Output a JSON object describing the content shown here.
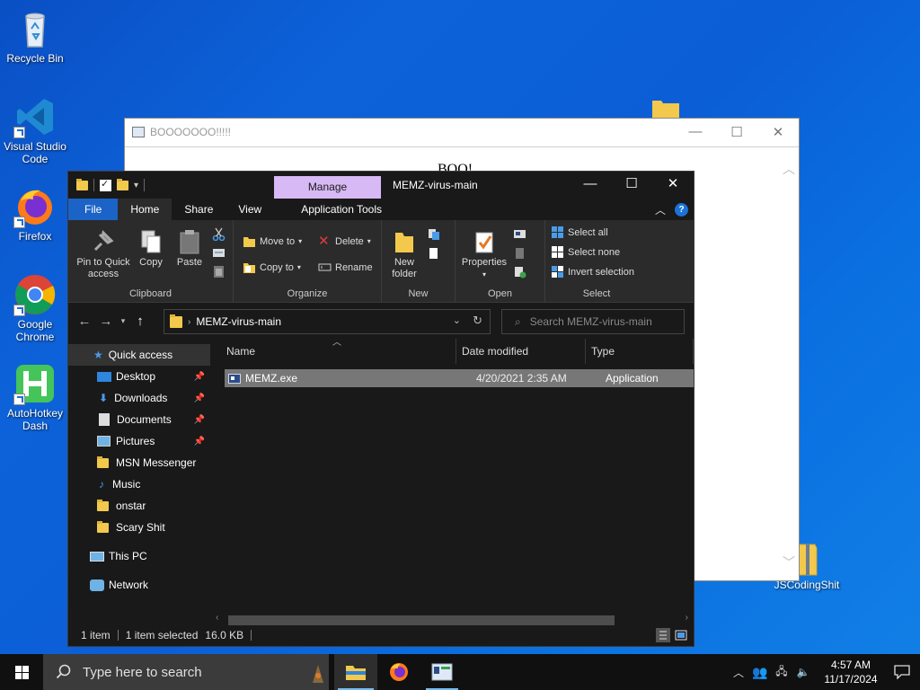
{
  "desktop": {
    "icons": [
      {
        "label": "Recycle Bin"
      },
      {
        "label": "Visual Studio Code"
      },
      {
        "label": "Firefox"
      },
      {
        "label": "Google Chrome"
      },
      {
        "label": "AutoHotkey Dash"
      },
      {
        "label": "JSCodingShit"
      }
    ]
  },
  "boo_window": {
    "title": "BOOOOOOO!!!!!",
    "body_text": "BOO!"
  },
  "explorer": {
    "title": "MEMZ-virus-main",
    "context_tab": "Manage",
    "ribbon_tabs": {
      "file": "File",
      "home": "Home",
      "share": "Share",
      "view": "View",
      "app_tools": "Application Tools"
    },
    "clipboard": {
      "pin": "Pin to Quick access",
      "copy": "Copy",
      "paste": "Paste",
      "label": "Clipboard"
    },
    "organize": {
      "move_to": "Move to",
      "copy_to": "Copy to",
      "delete": "Delete",
      "rename": "Rename",
      "label": "Organize"
    },
    "new": {
      "new_folder": "New folder",
      "label": "New"
    },
    "open": {
      "properties": "Properties",
      "label": "Open"
    },
    "select": {
      "select_all": "Select all",
      "select_none": "Select none",
      "invert": "Invert selection",
      "label": "Select"
    },
    "address": "MEMZ-virus-main",
    "search_placeholder": "Search MEMZ-virus-main",
    "nav": {
      "quick_access": "Quick access",
      "items": [
        {
          "label": "Desktop",
          "pinned": true
        },
        {
          "label": "Downloads",
          "pinned": true
        },
        {
          "label": "Documents",
          "pinned": true
        },
        {
          "label": "Pictures",
          "pinned": true
        },
        {
          "label": "MSN Messenger",
          "pinned": false
        },
        {
          "label": "Music",
          "pinned": false
        },
        {
          "label": "onstar",
          "pinned": false
        },
        {
          "label": "Scary Shit",
          "pinned": false
        }
      ],
      "this_pc": "This PC",
      "network": "Network"
    },
    "columns": {
      "name": "Name",
      "date": "Date modified",
      "type": "Type"
    },
    "files": [
      {
        "name": "MEMZ.exe",
        "date": "4/20/2021 2:35 AM",
        "type": "Application"
      }
    ],
    "status": {
      "count": "1 item",
      "selected": "1 item selected",
      "size": "16.0 KB"
    }
  },
  "taskbar": {
    "search_placeholder": "Type here to search",
    "time": "4:57 AM",
    "date": "11/17/2024"
  },
  "colors": {
    "accent": "#1b63c6",
    "manage_tab": "#d7b9f5",
    "selection": "#777777"
  }
}
